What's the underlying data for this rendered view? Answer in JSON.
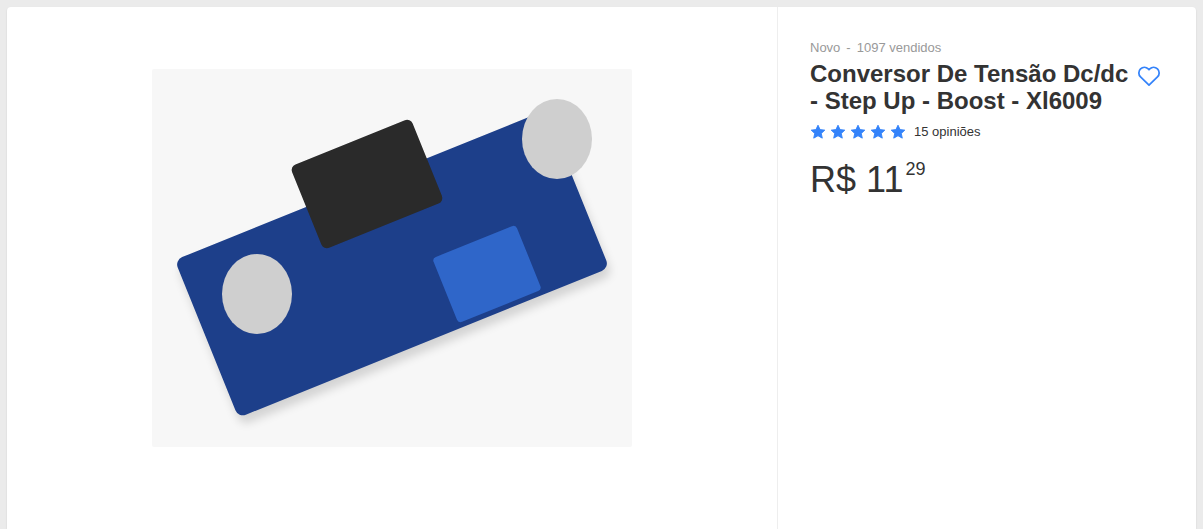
{
  "product": {
    "condition": "Novo",
    "separator": "-",
    "sold": "1097 vendidos",
    "title": "Conversor De Tensão Dc/dc - Step Up - Boost - Xl6009",
    "favorited": false,
    "rating": {
      "stars": 5,
      "reviews": "15 opiniões"
    },
    "price": {
      "currency": "R$",
      "integer": "11",
      "cents": "29"
    }
  }
}
